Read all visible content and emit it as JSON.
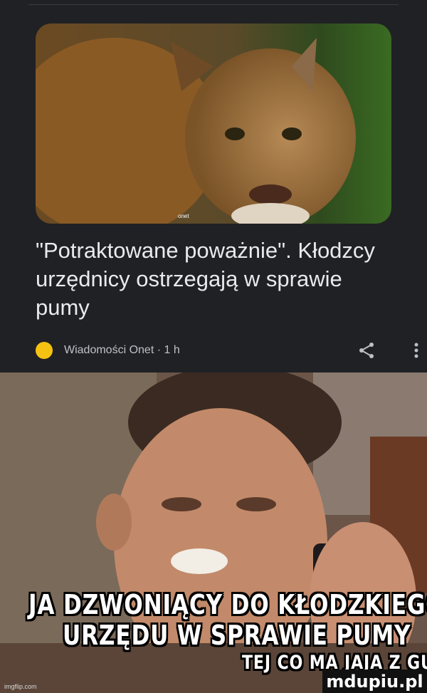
{
  "card": {
    "headline": "\"Potraktowane poważnie\". Kłodzcy urzędnicy ostrzegają w sprawie pumy",
    "source": "Wiadomości Onet · 1 h",
    "watermark": "onet",
    "icons": [
      "source-logo-icon",
      "share-icon",
      "more-options-icon"
    ]
  },
  "meme": {
    "line1": "JA DZWONIĄCY DO KŁODZKIEGO",
    "line2": "URZĘDU W SPRAWIE PUMY",
    "line3": "TEJ CO MA JAJA Z GUMY",
    "imgflip": "imgflip.com",
    "logo": "mdupiu.pl"
  },
  "colors": {
    "background": "#202124",
    "text": "#e8eaed",
    "source_dot": "#f6c211"
  }
}
